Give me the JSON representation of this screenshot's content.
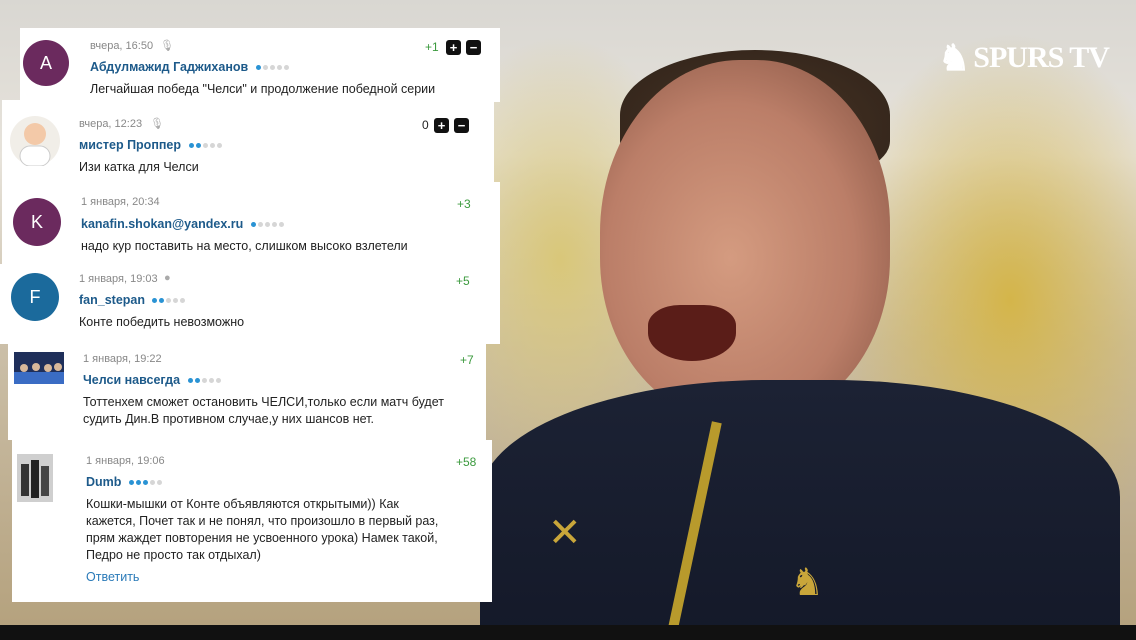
{
  "branding": {
    "title": "SPURS TV"
  },
  "comments": [
    {
      "avatar_letter": "A",
      "avatar_color": "#6b2a5e",
      "time": "вчера, 16:50",
      "device": "microphone-icon",
      "author": "Абдулмажид Гаджиханов",
      "rating_level": 1,
      "text": "Легчайшая победа \"Челси\" и продолжение победной серии",
      "score": "+1"
    },
    {
      "avatar_letter": "",
      "avatar_color": "#e8e8e8",
      "time": "вчера, 12:23",
      "device": "microphone-icon",
      "author": "мистер Проппер",
      "rating_level": 2,
      "text": "Изи катка для Челси",
      "score": "0"
    },
    {
      "avatar_letter": "K",
      "avatar_color": "#6b2a5e",
      "time": "1 января, 20:34",
      "author": "kanafin.shokan@yandex.ru",
      "rating_level": 1,
      "text": "надо кур поставить на место, слишком высоко взлетели",
      "score": "+3"
    },
    {
      "avatar_letter": "F",
      "avatar_color": "#1b6a9c",
      "time": "1 января, 19:03",
      "device": "apple-icon",
      "author": "fan_stepan",
      "rating_level": 2,
      "text": "Конте победить невозможно",
      "score": "+5"
    },
    {
      "avatar_letter": "",
      "avatar_color": "#2c3e66",
      "time": "1 января, 19:22",
      "author": "Челси навсегда",
      "rating_level": 2,
      "text_line1": "Тоттенхем сможет остановить ЧЕЛСИ,только если матч будет",
      "text_line2": "судить Дин.В противном случае,у них шансов нет.",
      "score": "+7"
    },
    {
      "avatar_letter": "",
      "avatar_color": "#555555",
      "time": "1 января, 19:06",
      "author": "Dumb",
      "rating_level": 3,
      "text_line1": "Кошки-мышки от Конте объявляются открытыми)) Как",
      "text_line2": "кажется, Почет так и не понял, что произошло в первый раз,",
      "text_line3": "прям жаждет повторения не усвоенного урока) Намек такой,",
      "text_line4": "Педро не просто так отдыхал)",
      "score": "+58",
      "reply_label": "Ответить"
    }
  ],
  "colors": {
    "link": "#1d5a8a",
    "score_positive": "#3b9a3e",
    "rating_on": "#2a93d4"
  }
}
